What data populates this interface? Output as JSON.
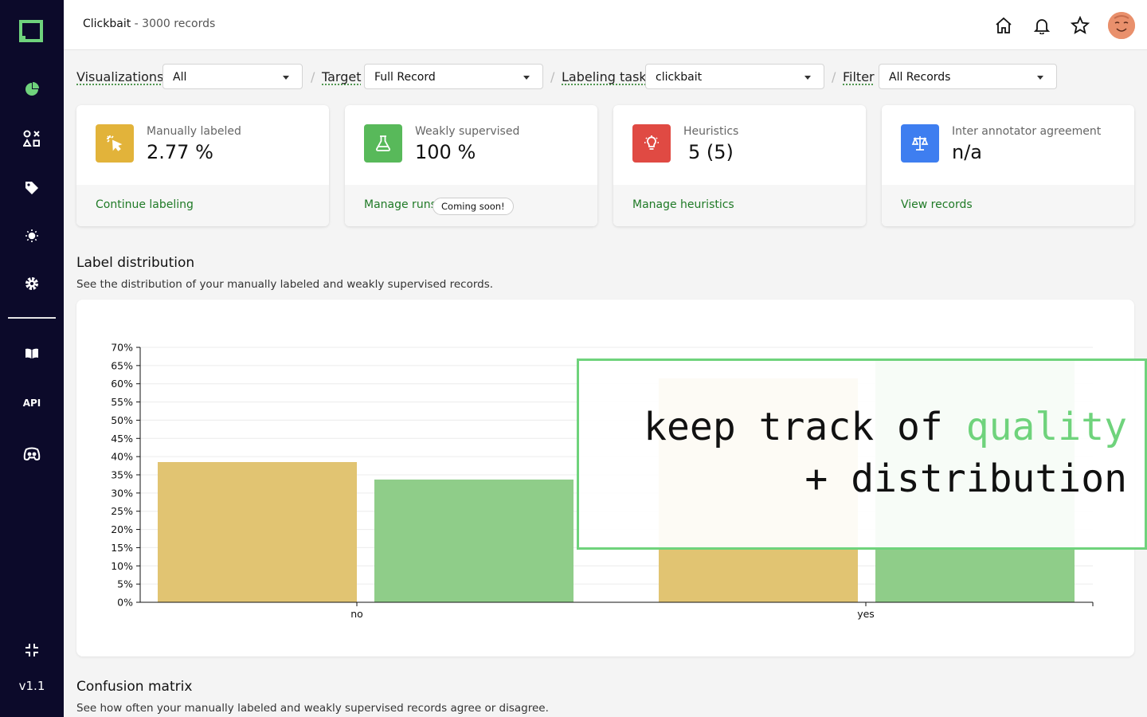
{
  "sidebar": {
    "version": "v1.1",
    "api_label": "API"
  },
  "header": {
    "project": "Clickbait",
    "separator": " - ",
    "records": "3000 records"
  },
  "filters": {
    "visualizations": {
      "label": "Visualizations",
      "value": "All"
    },
    "target": {
      "label": "Target",
      "value": "Full Record"
    },
    "labeling_task": {
      "label": "Labeling task",
      "value": "clickbait"
    },
    "filter": {
      "label": "Filter",
      "value": "All Records"
    },
    "separator": "/"
  },
  "cards": [
    {
      "label": "Manually labeled",
      "value": "2.77 %",
      "link": "Continue labeling",
      "color": "#e2b33a",
      "icon": "cursor-click-icon"
    },
    {
      "label": "Weakly supervised",
      "value": "100 %",
      "link": "Manage runs",
      "badge": "Coming soon!",
      "color": "#58b95a",
      "icon": "flask-icon"
    },
    {
      "label": "Heuristics",
      "value": "5 (5)",
      "link": "Manage heuristics",
      "color": "#e04a43",
      "icon": "lightbulb-icon"
    },
    {
      "label": "Inter annotator agreement",
      "value": "n/a",
      "link": "View records",
      "color": "#3e7ef0",
      "icon": "scale-icon"
    }
  ],
  "label_distribution": {
    "title": "Label distribution",
    "subtitle": "See the distribution of your manually labeled and weakly supervised records."
  },
  "confusion_matrix": {
    "title": "Confusion matrix",
    "subtitle": "See how often your manually labeled and weakly supervised records agree or disagree."
  },
  "chart_data": {
    "type": "bar",
    "categories": [
      "no",
      "yes"
    ],
    "series": [
      {
        "values": [
          0.385,
          0.615
        ],
        "color": "#e1c472"
      },
      {
        "values": [
          0.337,
          0.663
        ],
        "color": "#8fcd89"
      }
    ],
    "yticks": [
      "0%",
      "5%",
      "10%",
      "15%",
      "20%",
      "25%",
      "30%",
      "35%",
      "40%",
      "45%",
      "50%",
      "55%",
      "60%",
      "65%",
      "70%"
    ],
    "ylim": [
      0,
      0.7
    ],
    "grid": true
  },
  "callout": {
    "line1_prefix": "keep track of ",
    "line1_highlight": "quality",
    "line2": "+ distribution",
    "highlight_color": "#6fd37c"
  }
}
